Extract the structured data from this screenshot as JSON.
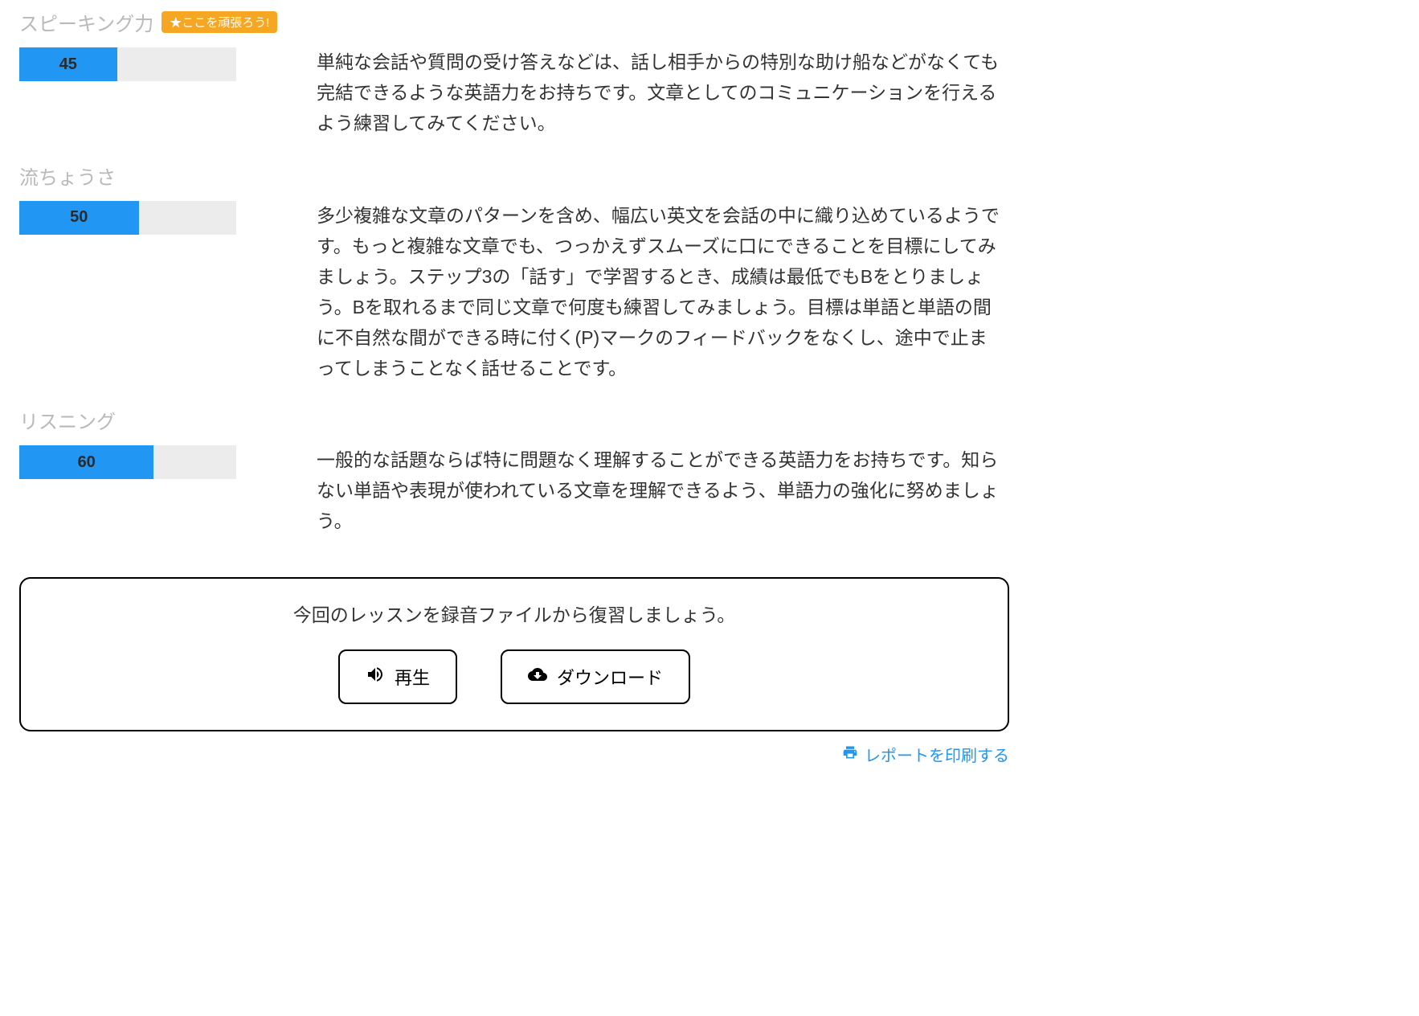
{
  "skills": [
    {
      "title": "スピーキング力",
      "badge": "★ここを頑張ろう!",
      "score": "45",
      "percent": 45,
      "desc": "単純な会話や質問の受け答えなどは、話し相手からの特別な助け船などがなくても完結できるような英語力をお持ちです。文章としてのコミュニケーションを行えるよう練習してみてください。"
    },
    {
      "title": "流ちょうさ",
      "badge": "",
      "score": "50",
      "percent": 55,
      "desc": "多少複雑な文章のパターンを含め、幅広い英文を会話の中に織り込めているようです。もっと複雑な文章でも、つっかえずスムーズに口にできることを目標にしてみましょう。ステップ3の「話す」で学習するとき、成績は最低でもBをとりましょう。Bを取れるまで同じ文章で何度も練習してみましょう。目標は単語と単語の間に不自然な間ができる時に付く(P)マークのフィードバックをなくし、途中で止まってしまうことなく話せることです。"
    },
    {
      "title": "リスニング",
      "badge": "",
      "score": "60",
      "percent": 62,
      "desc": "一般的な話題ならば特に問題なく理解することができる英語力をお持ちです。知らない単語や表現が使われている文章を理解できるよう、単語力の強化に努めましょう。"
    }
  ],
  "review": {
    "title": "今回のレッスンを録音ファイルから復習しましょう。",
    "play_label": "再生",
    "download_label": "ダウンロード"
  },
  "print_label": "レポートを印刷する",
  "colors": {
    "accent": "#2196f3",
    "badge": "#f5a623"
  }
}
